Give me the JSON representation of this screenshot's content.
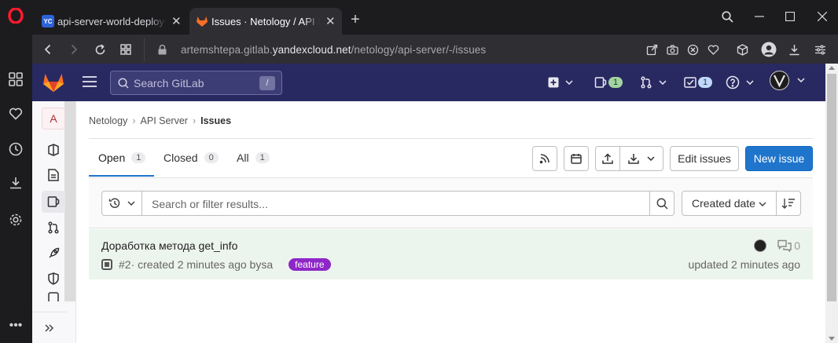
{
  "browser": {
    "tabs": [
      {
        "favicon_text": "YC",
        "title": "api-server-world-deployment"
      },
      {
        "title": "Issues · Netology / API Server"
      }
    ],
    "url_prefix": "artemshtepa.gitlab.",
    "url_host": "yandexcloud.net",
    "url_path": "/netology/api-server/-/issues"
  },
  "gitlab": {
    "search_placeholder": "Search GitLab",
    "search_shortcut": "/",
    "mr_count": "1",
    "todo_count": "1"
  },
  "sidebar": {
    "project_initial": "A"
  },
  "breadcrumb": {
    "items": [
      "Netology",
      "API Server",
      "Issues"
    ]
  },
  "issue_tabs": [
    {
      "label": "Open",
      "count": "1"
    },
    {
      "label": "Closed",
      "count": "0"
    },
    {
      "label": "All",
      "count": "1"
    }
  ],
  "actions": {
    "edit_issues": "Edit issues",
    "new_issue": "New issue"
  },
  "filter": {
    "placeholder": "Search or filter results...",
    "sort_label": "Created date"
  },
  "issues": [
    {
      "title": "Доработка метода get_info",
      "ref": "#2",
      "meta": " · created 2 minutes ago by ",
      "author": "sa",
      "label": "feature",
      "comments": "0",
      "updated": "updated 2 minutes ago"
    }
  ],
  "colors": {
    "gitlab_nav": "#292961",
    "primary": "#1f75cb",
    "label_feature": "#8e27c7",
    "row_highlight": "#ecf4ee"
  }
}
